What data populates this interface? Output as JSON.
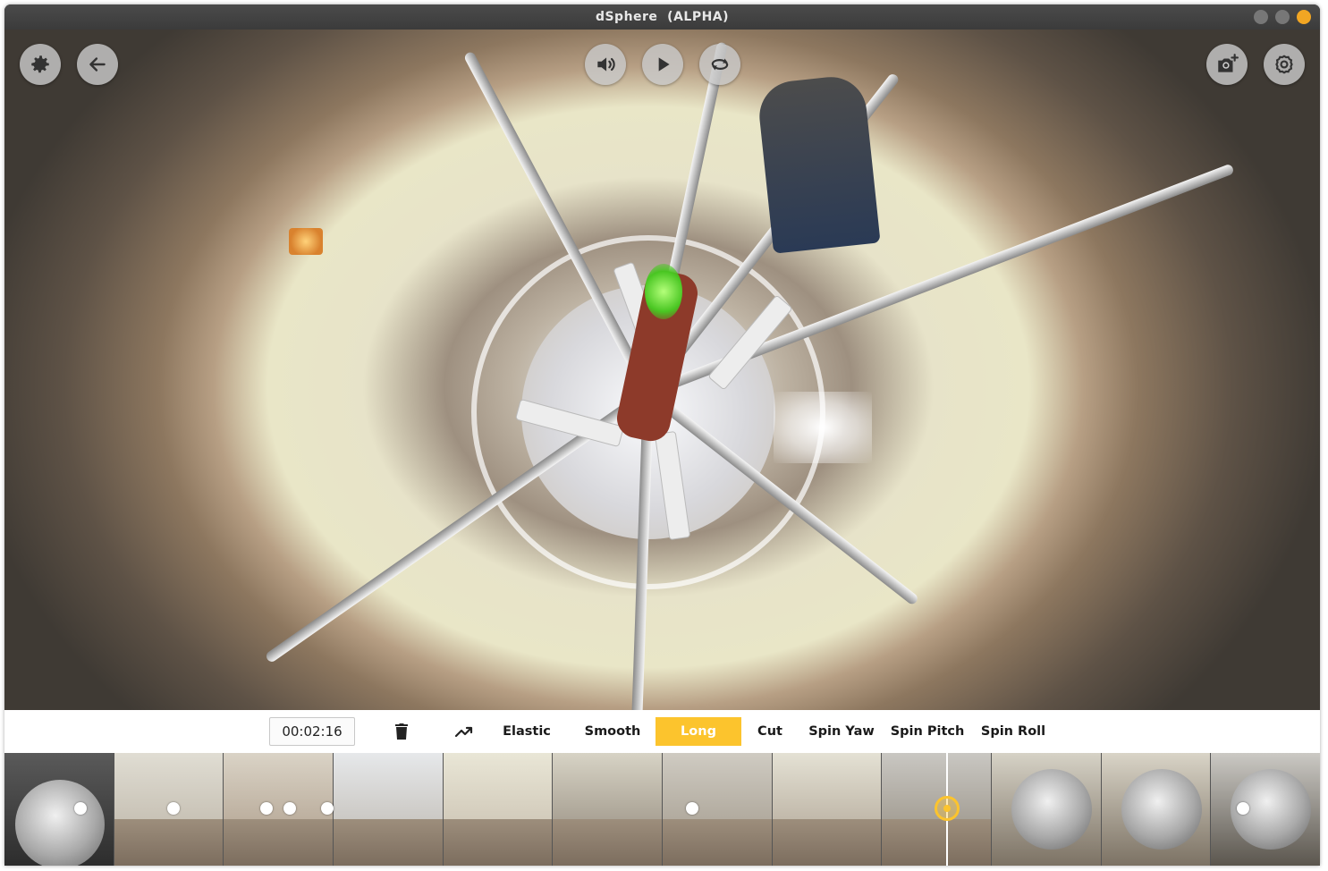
{
  "window": {
    "title": "dSphere  (ALPHA)"
  },
  "viewer": {
    "left_buttons": [
      {
        "name": "settings-icon",
        "label": "Settings"
      },
      {
        "name": "back-arrow-icon",
        "label": "Back"
      }
    ],
    "center_buttons": [
      {
        "name": "volume-icon",
        "label": "Volume"
      },
      {
        "name": "play-icon",
        "label": "Play"
      },
      {
        "name": "loop-icon",
        "label": "Loop"
      }
    ],
    "right_buttons": [
      {
        "name": "add-camera-icon",
        "label": "Add snapshot"
      },
      {
        "name": "preferences-gear-icon",
        "label": "Preferences"
      }
    ]
  },
  "toolbar": {
    "time": "00:02:16",
    "modes": [
      {
        "label": "Elastic",
        "active": false
      },
      {
        "label": "Smooth",
        "active": false
      },
      {
        "label": "Long",
        "active": true
      },
      {
        "label": "Cut",
        "active": false
      },
      {
        "label": "Spin Yaw",
        "active": false
      },
      {
        "label": "Spin Pitch",
        "active": false
      },
      {
        "label": "Spin Roll",
        "active": false
      }
    ]
  },
  "timeline": {
    "thumbnail_count": 12,
    "keyframe_count": 8
  },
  "colors": {
    "accent": "#fcc42d",
    "titlebar": "#3f3f3f",
    "close_button": "#f2a623"
  }
}
